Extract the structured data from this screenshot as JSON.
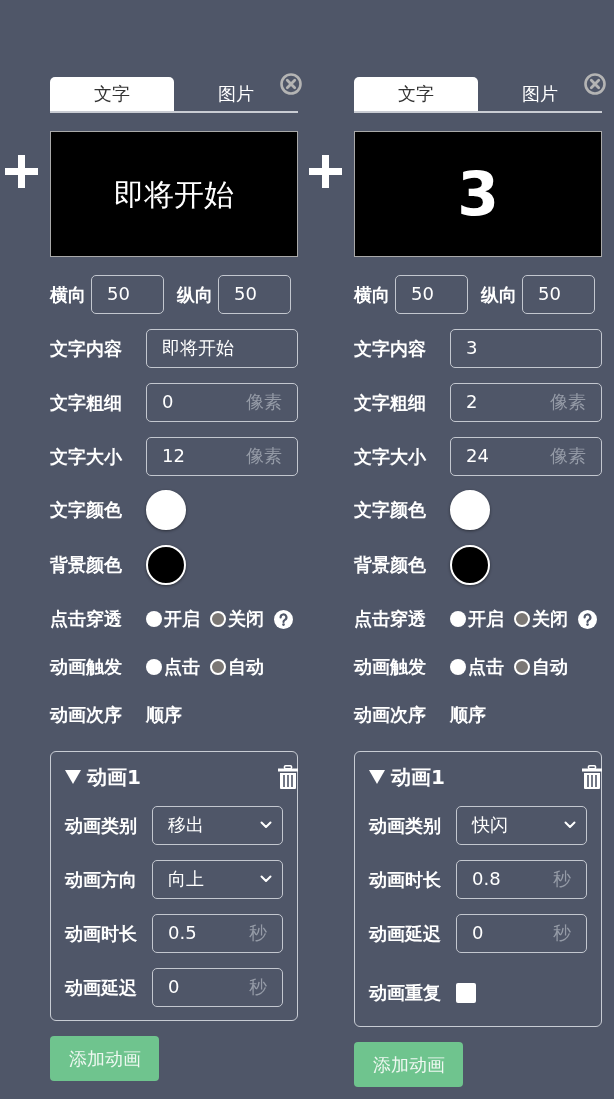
{
  "panels": [
    {
      "tabs": [
        {
          "label": "文字",
          "selected": true
        },
        {
          "label": "图片",
          "selected": false
        }
      ],
      "preview": {
        "text": "即将开始"
      },
      "position": [
        {
          "label": "横向",
          "value": "50"
        },
        {
          "label": "纵向",
          "value": "50"
        }
      ],
      "fields": [
        {
          "label": "文字内容",
          "value": "即将开始"
        },
        {
          "label": "文字粗细",
          "value": "0",
          "unit": "像素"
        },
        {
          "label": "文字大小",
          "value": "12",
          "unit": "像素"
        }
      ],
      "colors": [
        {
          "label": "文字颜色",
          "color": "#ffffff"
        },
        {
          "label": "背景颜色",
          "color": "#000000"
        }
      ],
      "options": [
        {
          "label": "点击穿透",
          "help": true,
          "choices": [
            {
              "label": "开启",
              "selected": false
            },
            {
              "label": "关闭",
              "selected": true
            }
          ]
        },
        {
          "label": "动画触发",
          "help": false,
          "choices": [
            {
              "label": "点击",
              "selected": false
            },
            {
              "label": "自动",
              "selected": true
            }
          ]
        }
      ],
      "order": {
        "label": "动画次序",
        "value": "顺序"
      },
      "animations": [
        {
          "title": "动画1",
          "expanded": true,
          "fields": [
            {
              "kind": "select",
              "label": "动画类别",
              "value": "移出"
            },
            {
              "kind": "select",
              "label": "动画方向",
              "value": "向上"
            },
            {
              "kind": "number",
              "label": "动画时长",
              "value": "0.5",
              "unit": "秒"
            },
            {
              "kind": "number",
              "label": "动画延迟",
              "value": "0",
              "unit": "秒"
            }
          ]
        }
      ],
      "add_button": {
        "label": "添加动画"
      }
    },
    {
      "tabs": [
        {
          "label": "文字",
          "selected": true
        },
        {
          "label": "图片",
          "selected": false
        }
      ],
      "preview": {
        "text": "3"
      },
      "position": [
        {
          "label": "横向",
          "value": "50"
        },
        {
          "label": "纵向",
          "value": "50"
        }
      ],
      "fields": [
        {
          "label": "文字内容",
          "value": "3"
        },
        {
          "label": "文字粗细",
          "value": "2",
          "unit": "像素"
        },
        {
          "label": "文字大小",
          "value": "24",
          "unit": "像素"
        }
      ],
      "colors": [
        {
          "label": "文字颜色",
          "color": "#ffffff"
        },
        {
          "label": "背景颜色",
          "color": "#000000"
        }
      ],
      "options": [
        {
          "label": "点击穿透",
          "help": true,
          "choices": [
            {
              "label": "开启",
              "selected": false
            },
            {
              "label": "关闭",
              "selected": true
            }
          ]
        },
        {
          "label": "动画触发",
          "help": false,
          "choices": [
            {
              "label": "点击",
              "selected": false
            },
            {
              "label": "自动",
              "selected": true
            }
          ]
        }
      ],
      "order": {
        "label": "动画次序",
        "value": "顺序"
      },
      "animations": [
        {
          "title": "动画1",
          "expanded": true,
          "fields": [
            {
              "kind": "select",
              "label": "动画类别",
              "value": "快闪"
            },
            {
              "kind": "number",
              "label": "动画时长",
              "value": "0.8",
              "unit": "秒"
            },
            {
              "kind": "number",
              "label": "动画延迟",
              "value": "0",
              "unit": "秒"
            },
            {
              "kind": "checkbox",
              "label": "动画重复",
              "checked": false
            }
          ]
        }
      ],
      "add_button": {
        "label": "添加动画"
      }
    }
  ]
}
